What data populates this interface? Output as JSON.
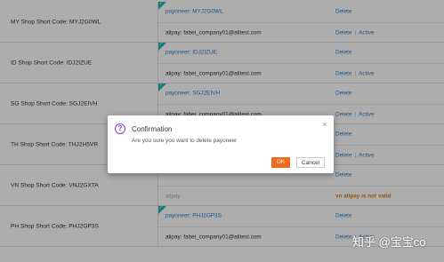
{
  "rows": [
    {
      "code_label": "MY Shop Short Code: MYJ2G0WL",
      "accounts": [
        {
          "type": "payoneer",
          "text": "payoneer: MYJ2G0WL",
          "verified": true,
          "actions": [
            "Delete"
          ]
        },
        {
          "type": "alipay",
          "text": "alipay: fabei_company01@alitest.com",
          "actions": [
            "Delete",
            "Active"
          ]
        }
      ]
    },
    {
      "code_label": "ID Shop Short Code: IDJ2IZUE",
      "accounts": [
        {
          "type": "payoneer",
          "text": "payoneer: IDJ2IZUE",
          "verified": true,
          "actions": [
            "Delete"
          ]
        },
        {
          "type": "alipay",
          "text": "alipay: fabei_company01@alitest.com",
          "actions": [
            "Delete",
            "Active"
          ]
        }
      ]
    },
    {
      "code_label": "SG Shop Short Code: SGJ2EIVH",
      "accounts": [
        {
          "type": "payoneer",
          "text": "payoneer: SGJ2EIVH",
          "verified": true,
          "actions": [
            "Delete"
          ]
        },
        {
          "type": "alipay",
          "text": "alipay: fabei_company01@alitest.com",
          "actions": [
            "Delete",
            "Active"
          ]
        }
      ]
    },
    {
      "code_label": "TH Shop Short Code: THJ2H5VR",
      "accounts": [
        {
          "type": "payoneer",
          "text": "",
          "verified": false,
          "actions": [
            "Delete"
          ]
        },
        {
          "type": "alipay",
          "text": "",
          "actions": [
            "Delete",
            "Active"
          ]
        }
      ]
    },
    {
      "code_label": "VN Shop Short Code: VNJ2GXTA",
      "accounts": [
        {
          "type": "payoneer",
          "text": "",
          "verified": false,
          "actions": [
            "Delete"
          ]
        },
        {
          "type": "alipay",
          "text": "alipay",
          "actions": [],
          "warning": "vn alipay is not valid",
          "muted": true
        }
      ]
    },
    {
      "code_label": "PH Shop Short Code: PHJ2GP3S",
      "accounts": [
        {
          "type": "payoneer",
          "text": "payoneer: PHJ2GP3S",
          "verified": true,
          "actions": [
            "Delete"
          ]
        },
        {
          "type": "alipay",
          "text": "alipay: fabei_company01@alitest.com",
          "actions": [
            "Delete",
            "Active"
          ]
        }
      ]
    }
  ],
  "dialog": {
    "title": "Confirmation",
    "message": "Are you sure you want to delete payoneer",
    "ok_label": "OK",
    "cancel_label": "Cancel",
    "close_glyph": "×",
    "icon_glyph": "?"
  },
  "watermark": "知乎 @宝宝co",
  "colors": {
    "accent": "#f06a1e",
    "link": "#2f7ec4",
    "warning": "#e47a10",
    "verified_tag": "#1fb3b6",
    "dialog_icon": "#8d3fcf"
  }
}
